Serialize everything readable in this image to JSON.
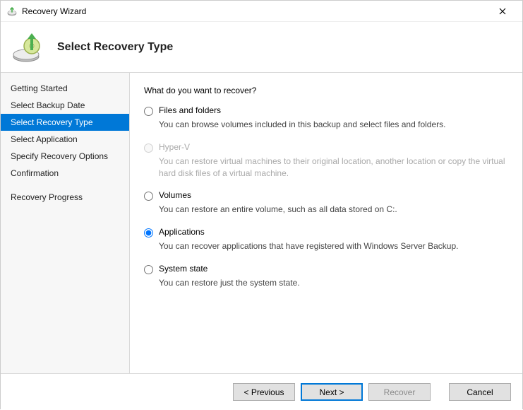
{
  "window": {
    "title": "Recovery Wizard"
  },
  "header": {
    "title": "Select Recovery Type"
  },
  "sidebar": {
    "steps": [
      {
        "label": "Getting Started",
        "selected": false
      },
      {
        "label": "Select Backup Date",
        "selected": false
      },
      {
        "label": "Select Recovery Type",
        "selected": true
      },
      {
        "label": "Select Application",
        "selected": false
      },
      {
        "label": "Specify Recovery Options",
        "selected": false
      },
      {
        "label": "Confirmation",
        "selected": false
      },
      {
        "label": "Recovery Progress",
        "selected": false
      }
    ]
  },
  "content": {
    "question": "What do you want to recover?",
    "options": [
      {
        "id": "files-folders",
        "label": "Files and folders",
        "description": "You can browse volumes included in this backup and select files and folders.",
        "enabled": true,
        "checked": false
      },
      {
        "id": "hyper-v",
        "label": "Hyper-V",
        "description": "You can restore virtual machines to their original location, another location or copy the virtual hard disk files of a virtual machine.",
        "enabled": false,
        "checked": false
      },
      {
        "id": "volumes",
        "label": "Volumes",
        "description": "You can restore an entire volume, such as all data stored on C:.",
        "enabled": true,
        "checked": false
      },
      {
        "id": "applications",
        "label": "Applications",
        "description": "You can recover applications that have registered with Windows Server Backup.",
        "enabled": true,
        "checked": true
      },
      {
        "id": "system-state",
        "label": "System state",
        "description": "You can restore just the system state.",
        "enabled": true,
        "checked": false
      }
    ]
  },
  "footer": {
    "previous": "< Previous",
    "next": "Next >",
    "recover": "Recover",
    "cancel": "Cancel",
    "recover_enabled": false
  }
}
